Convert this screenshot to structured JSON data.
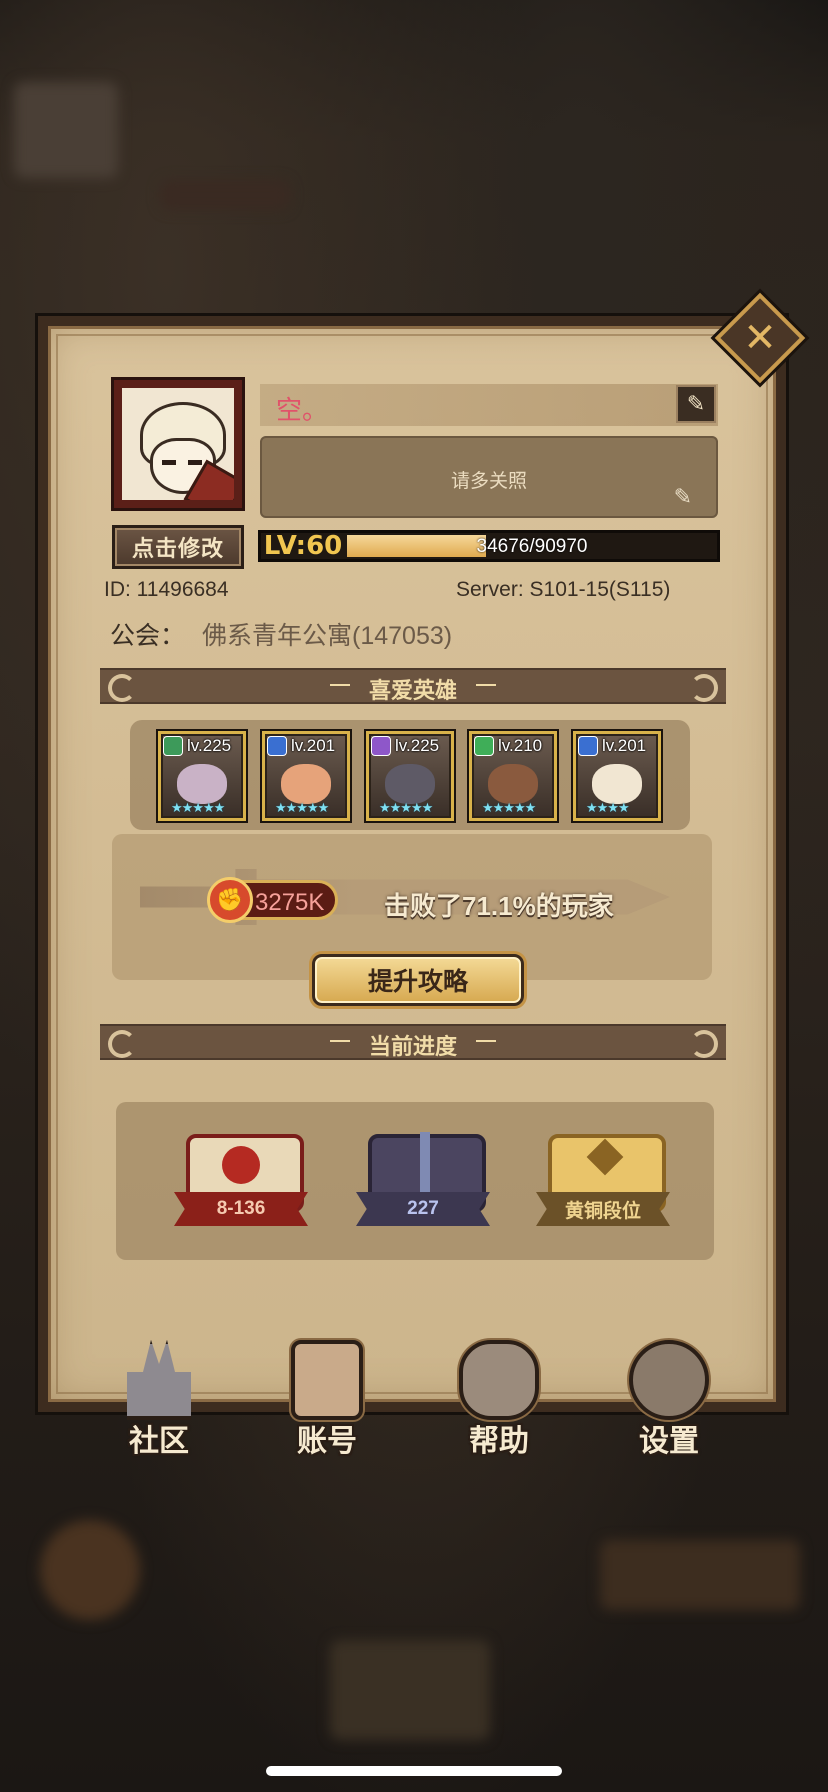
{
  "profile": {
    "name": "空。",
    "signature": "请多关照",
    "edit_avatar_label": "点击修改",
    "level_label": "LV:60",
    "xp_text": "34676/90970",
    "xp_fraction": 0.381,
    "id_text": "ID:  11496684",
    "server_text": "Server:  S101-15(S115)",
    "guild_label": "公会：",
    "guild_value": "佛系青年公寓(147053)"
  },
  "favorite_heroes": {
    "title": "喜爱英雄",
    "heroes": [
      {
        "level": "lv.225",
        "class_color": "#3d9a5a",
        "stars": "★★★★★"
      },
      {
        "level": "lv.201",
        "class_color": "#3a6fd1",
        "stars": "★★★★★"
      },
      {
        "level": "lv.225",
        "class_color": "#8e57c9",
        "stars": "★★★★★"
      },
      {
        "level": "lv.210",
        "class_color": "#3fae58",
        "stars": "★★★★★"
      },
      {
        "level": "lv.201",
        "class_color": "#3a6fd1",
        "stars": "★★★★"
      }
    ]
  },
  "power": {
    "value": "3275K",
    "defeat_text": "击败了71.1%的玩家",
    "guide_button": "提升攻略"
  },
  "current_progress": {
    "title": "当前进度",
    "items": [
      {
        "label": "8-136",
        "icon": "campaign-book-icon"
      },
      {
        "label": "227",
        "icon": "tower-sword-icon"
      },
      {
        "label": "黄铜段位",
        "icon": "arena-rank-icon"
      }
    ]
  },
  "nav": {
    "community": "社区",
    "account": "账号",
    "help": "帮助",
    "settings": "设置"
  },
  "colors": {
    "accent_gold": "#d8b24a",
    "name_pink": "#e0536a",
    "banner_brown": "#6b5440"
  }
}
